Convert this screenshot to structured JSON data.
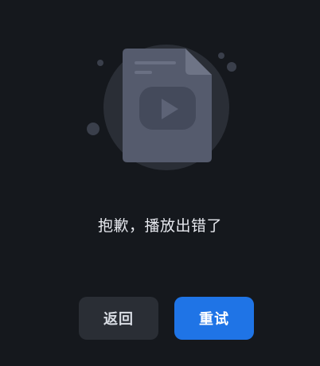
{
  "error": {
    "message": "抱歉，播放出错了"
  },
  "actions": {
    "back_label": "返回",
    "retry_label": "重试"
  },
  "icons": {
    "illustration": "video-file-error-icon",
    "play": "play-icon"
  },
  "colors": {
    "background": "#15181d",
    "circle": "#2a2e36",
    "document": "#555b6d",
    "document_fold": "#6e7486",
    "play_box": "#444a5b",
    "play_triangle": "#5d6376",
    "dots": "#3a3f4b",
    "primary_button": "#1f74e6",
    "secondary_button": "#2a2e35"
  }
}
